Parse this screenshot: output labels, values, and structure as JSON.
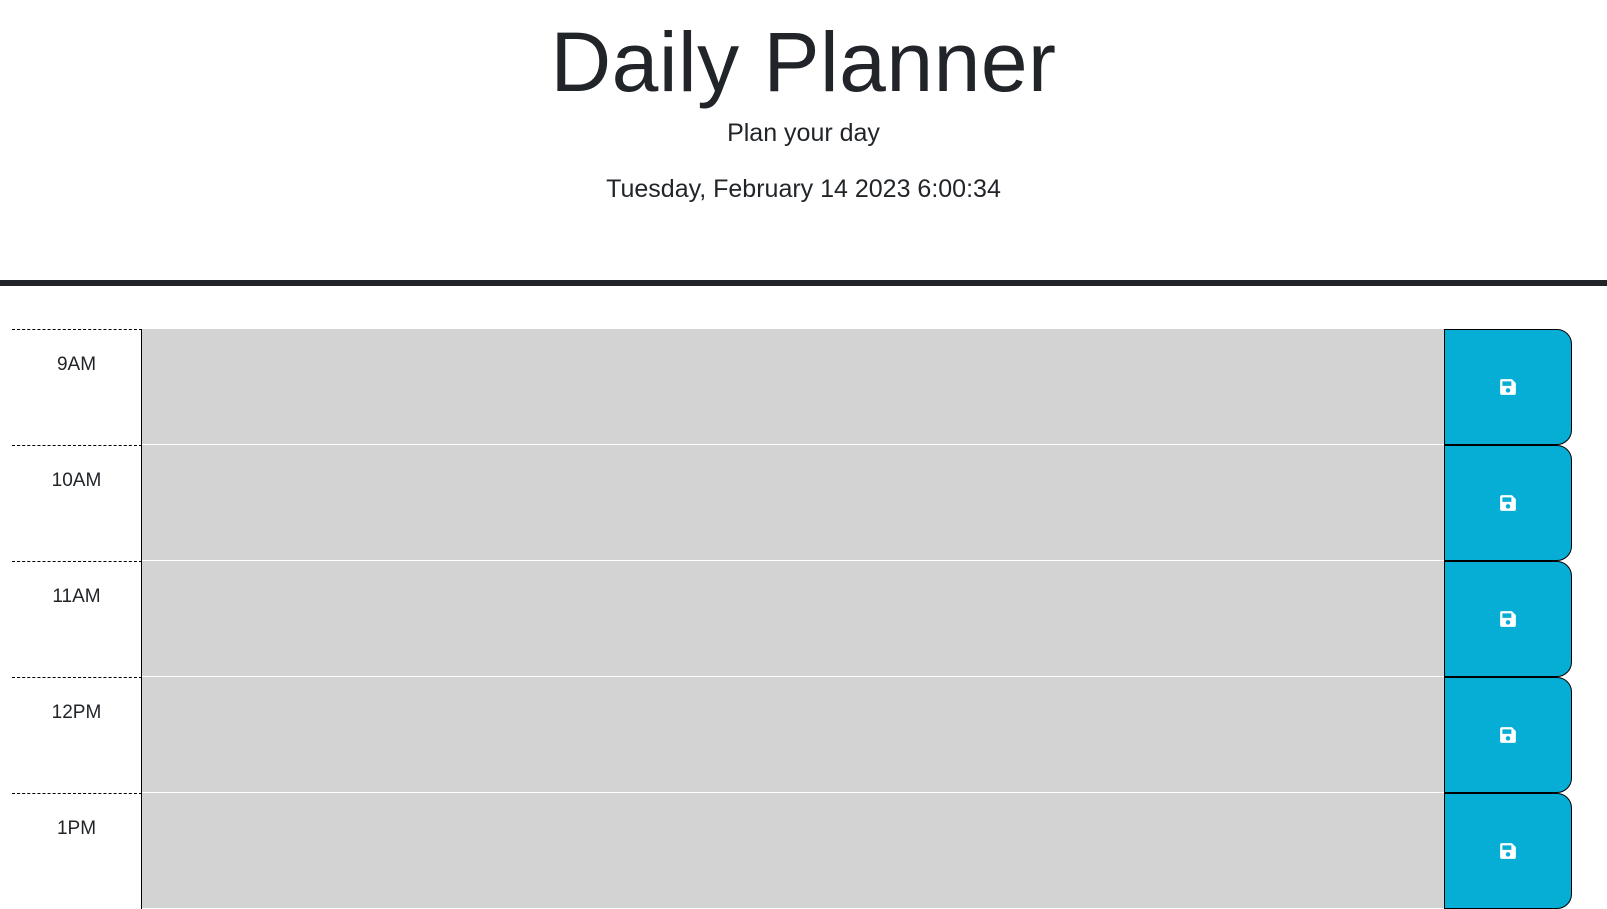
{
  "header": {
    "title": "Daily Planner",
    "subtitle": "Plan your day",
    "current_day": "Tuesday, February 14 2023 6:00:34"
  },
  "colors": {
    "past": "#d3d3d3",
    "save_button": "#06aed5",
    "divider": "#212529"
  },
  "time_blocks": [
    {
      "hour": "9AM",
      "description": "",
      "status": "past"
    },
    {
      "hour": "10AM",
      "description": "",
      "status": "past"
    },
    {
      "hour": "11AM",
      "description": "",
      "status": "past"
    },
    {
      "hour": "12PM",
      "description": "",
      "status": "past"
    },
    {
      "hour": "1PM",
      "description": "",
      "status": "past"
    }
  ],
  "save_icon": "save-icon"
}
